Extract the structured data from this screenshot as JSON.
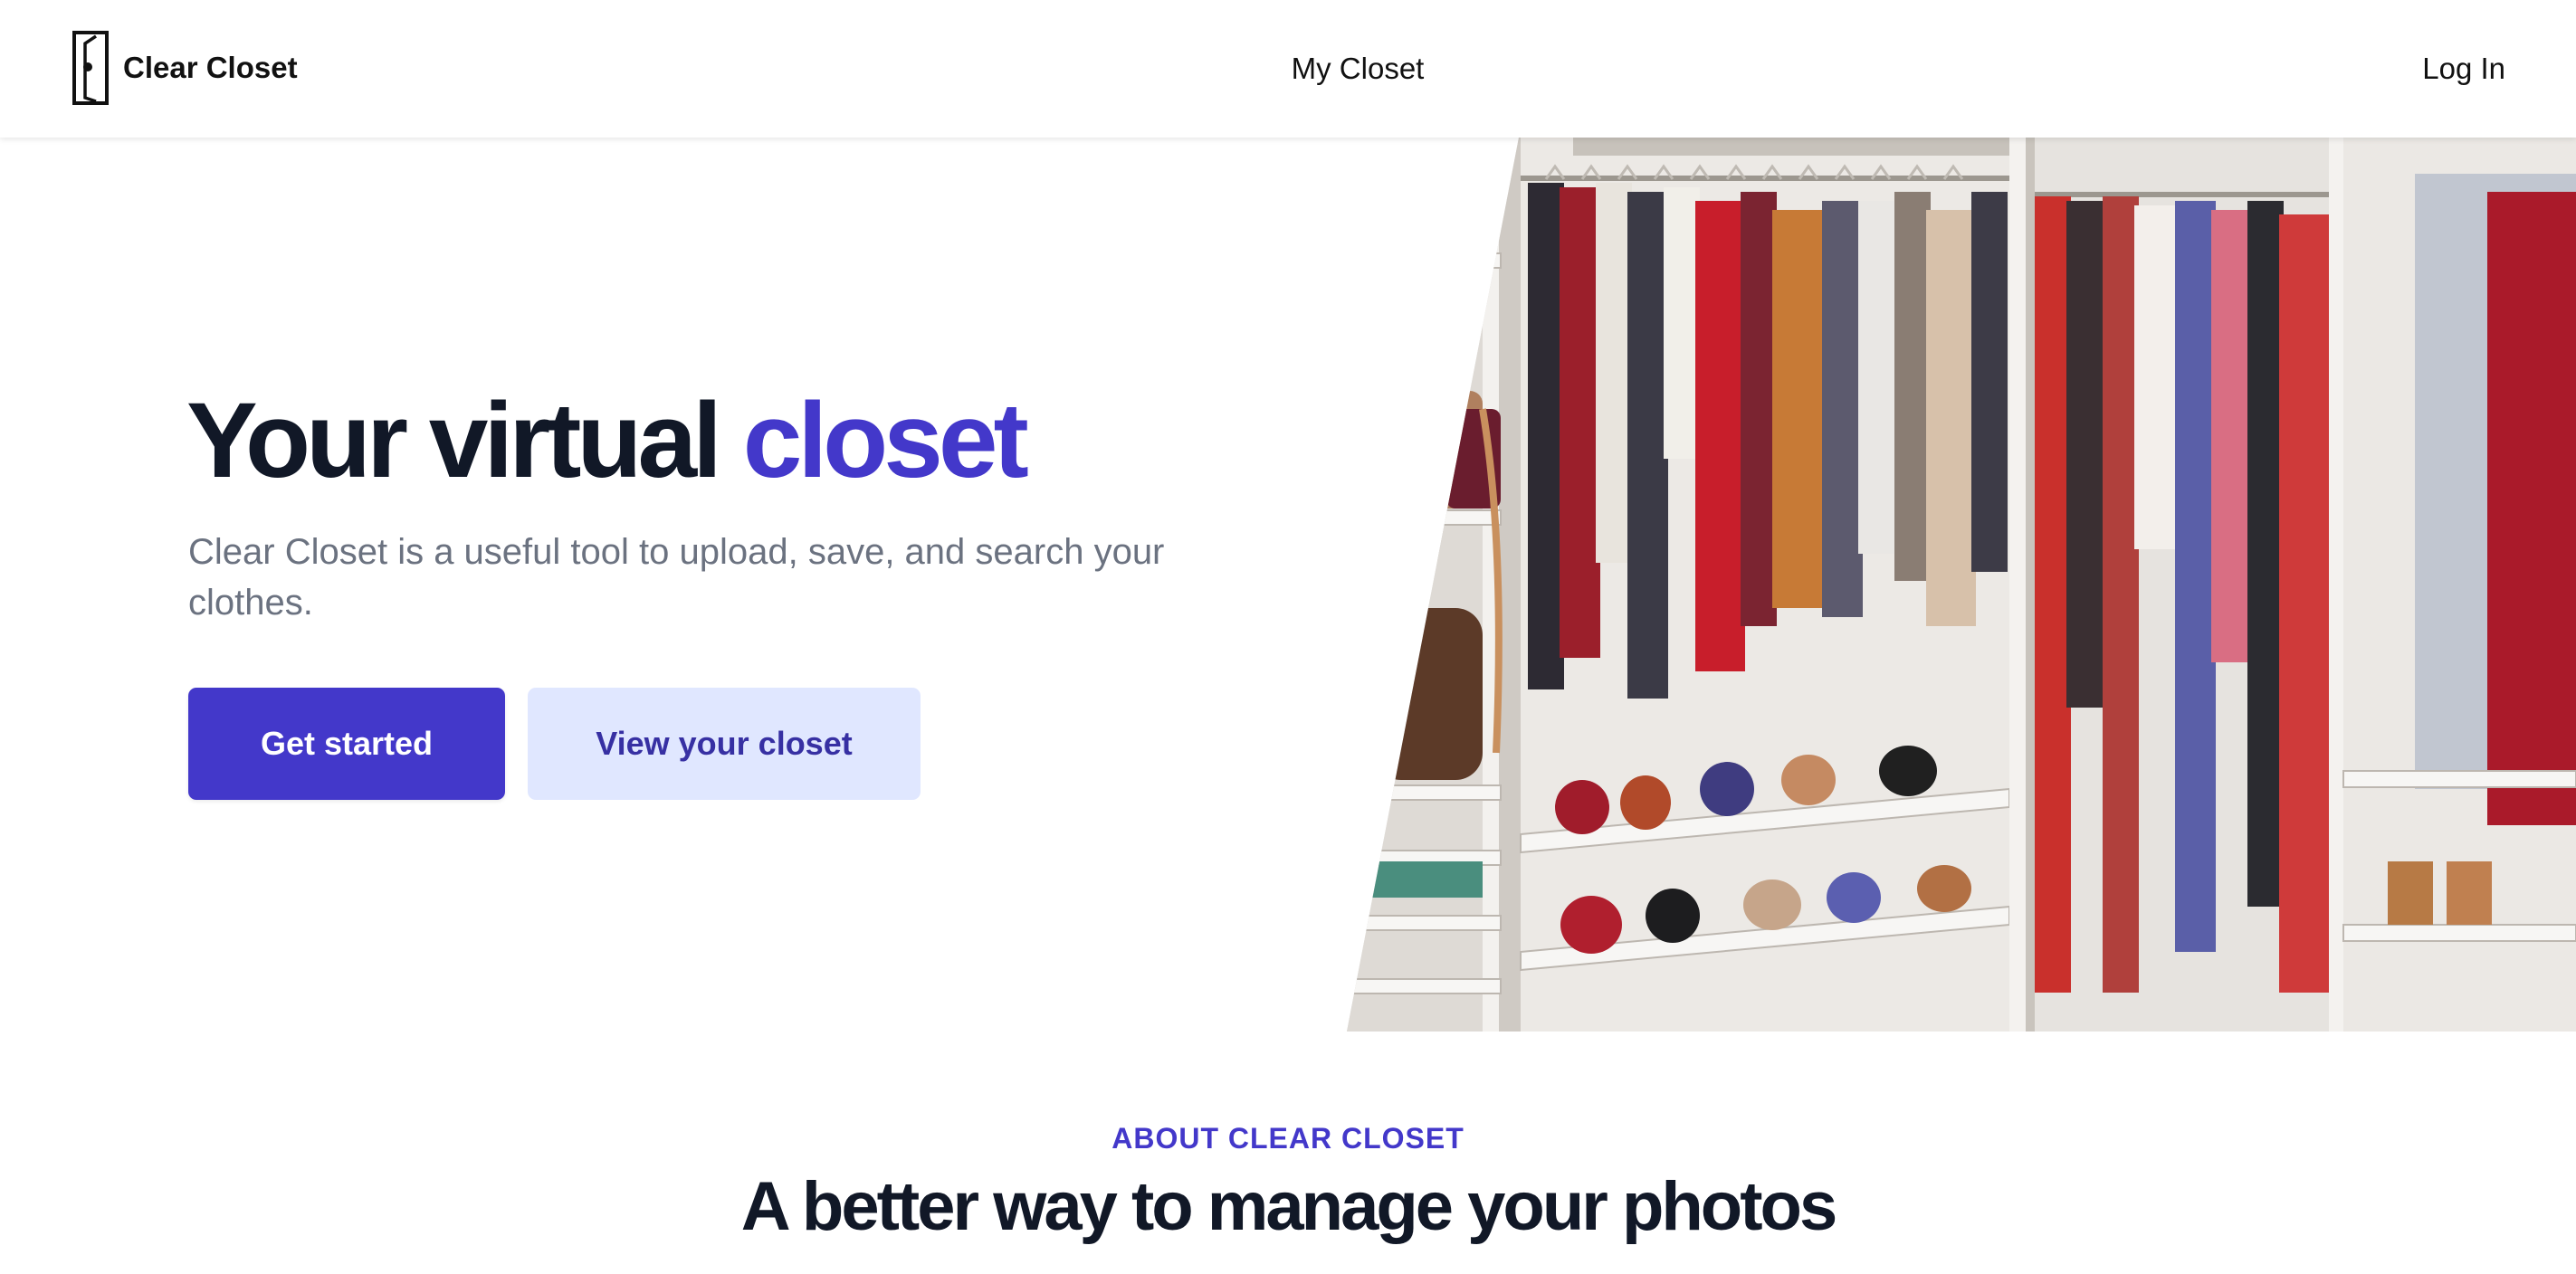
{
  "header": {
    "brand": "Clear Closet",
    "logo_icon": "closet-door-icon",
    "nav_center": "My Closet",
    "nav_right": "Log In"
  },
  "hero": {
    "title_main": "Your virtual ",
    "title_accent": "closet",
    "subtitle": "Clear Closet is a useful tool to upload, save, and search your clothes.",
    "primary_button": "Get started",
    "secondary_button": "View your closet",
    "image": "closet-photo"
  },
  "about": {
    "eyebrow": "ABOUT CLEAR CLOSET",
    "title": "A better way to manage your photos"
  },
  "colors": {
    "accent": "#4338ca",
    "accent_light": "#e0e7ff",
    "text_dark": "#111827",
    "text_muted": "#6b7280"
  }
}
